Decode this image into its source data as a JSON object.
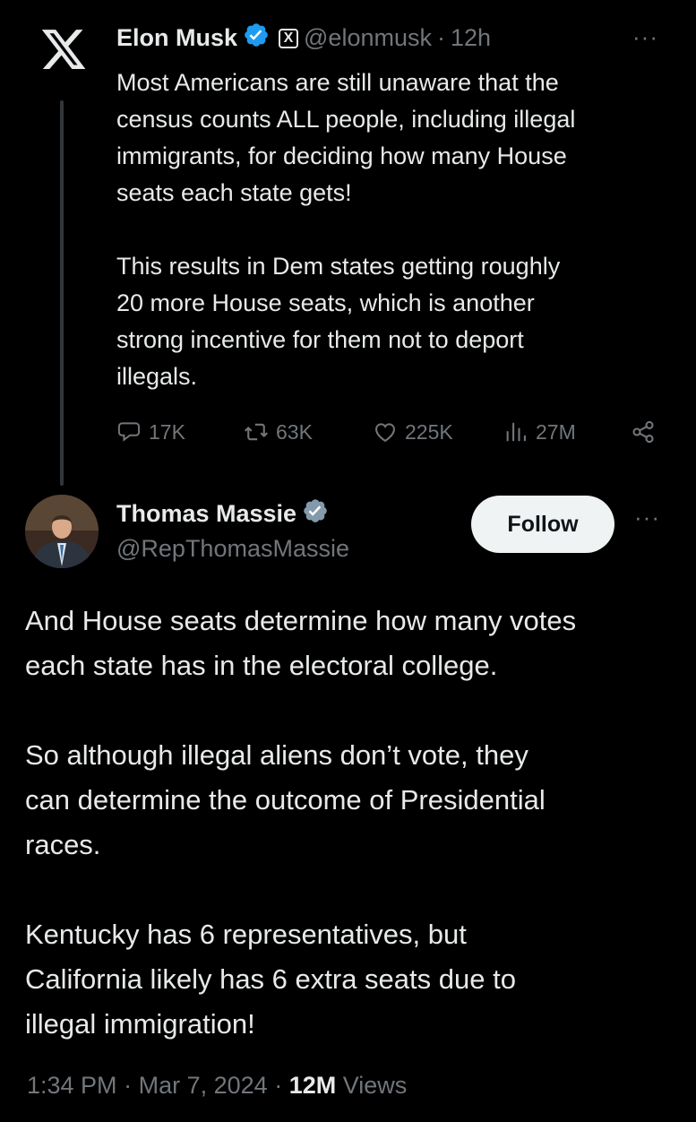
{
  "tweet1": {
    "name": "Elon Musk",
    "affiliate_badge": "X",
    "handle": "@elonmusk",
    "separator": "·",
    "time": "12h",
    "more": "···",
    "text": "Most Americans are still unaware that the\ncensus counts ALL people, including illegal\nimmigrants, for deciding how many House\nseats each state gets!\n\nThis results in Dem states getting roughly\n20 more House seats, which is another\nstrong incentive for them not to deport\nillegals.",
    "replies": "17K",
    "reposts": "63K",
    "likes": "225K",
    "views": "27M"
  },
  "tweet2": {
    "name": "Thomas Massie",
    "handle": "@RepThomasMassie",
    "follow_label": "Follow",
    "more": "···",
    "text": "And House seats determine how many votes\neach state has in the electoral college.\n\nSo although illegal aliens don’t vote, they\ncan determine the outcome of Presidential\nraces.\n\nKentucky has 6 representatives, but\nCalifornia likely has 6 extra seats due to\nillegal immigration!",
    "time": "1:34 PM",
    "sep1": "·",
    "date": "Mar 7, 2024",
    "sep2": "·",
    "views_count": "12M",
    "views_label": "Views"
  },
  "colors": {
    "background": "#000000",
    "text": "#e7e9ea",
    "muted": "#71767b",
    "verified": "#1d9bf0",
    "follow_bg": "#eff3f4"
  }
}
